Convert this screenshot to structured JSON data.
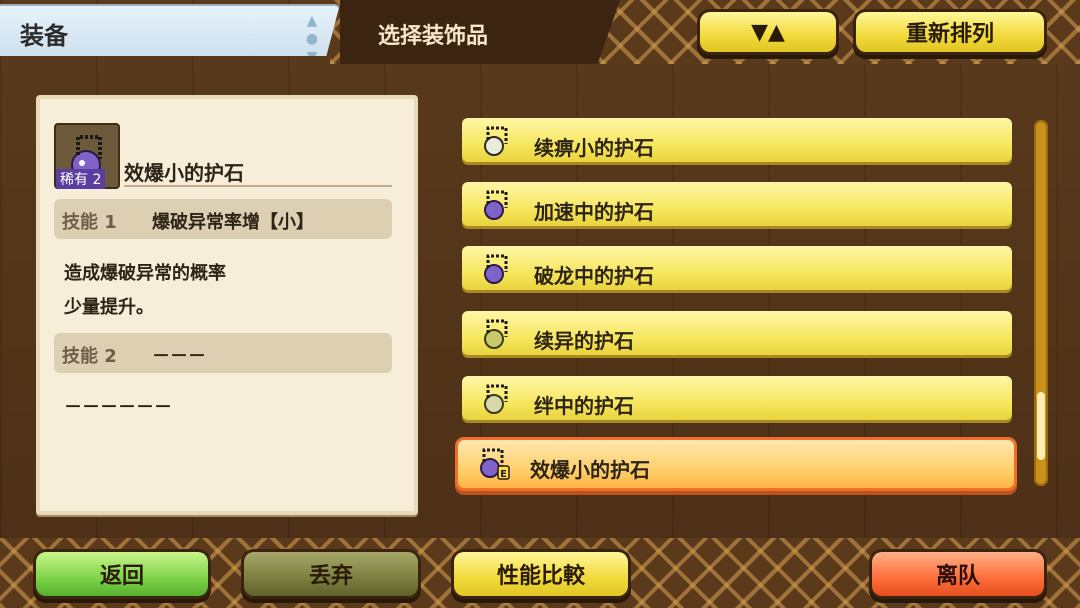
{
  "header": {
    "tab_label": "装备",
    "subtitle": "选择装饰品",
    "sort_arrows": "▼▲",
    "reorder_label": "重新排列"
  },
  "detail": {
    "rarity": "稀有 2",
    "name": "效爆小的护石",
    "skill1_label": "技能 1",
    "skill1_value": "爆破异常率增【小】",
    "desc_line1": "造成爆破异常的概率",
    "desc_line2": "少量提升。",
    "skill2_label": "技能 2",
    "skill2_value": "－－－",
    "skill2_desc": "－－－－－－"
  },
  "list": {
    "items": [
      {
        "label": "续痹小的护石",
        "orb_color": "#e9ecd8",
        "selected": false
      },
      {
        "label": "加速中的护石",
        "orb_color": "#7f63c9",
        "selected": false
      },
      {
        "label": "破龙中的护石",
        "orb_color": "#7f63c9",
        "selected": false
      },
      {
        "label": "续异的护石",
        "orb_color": "#c7c96a",
        "selected": false
      },
      {
        "label": "绊中的护石",
        "orb_color": "#d8d8a8",
        "selected": false
      },
      {
        "label": "效爆小的护石",
        "orb_color": "#7f63c9",
        "selected": true,
        "badge": "E"
      }
    ]
  },
  "bottom": {
    "back": "返回",
    "discard": "丢弃",
    "compare": "性能比較",
    "leave": "离队"
  },
  "colors": {
    "wood": "#5a3a1c",
    "yellow_button": "#f1d93a",
    "green_button": "#7ed348",
    "orange_button": "#ff6d3a",
    "selection_border": "#f16d2a"
  }
}
